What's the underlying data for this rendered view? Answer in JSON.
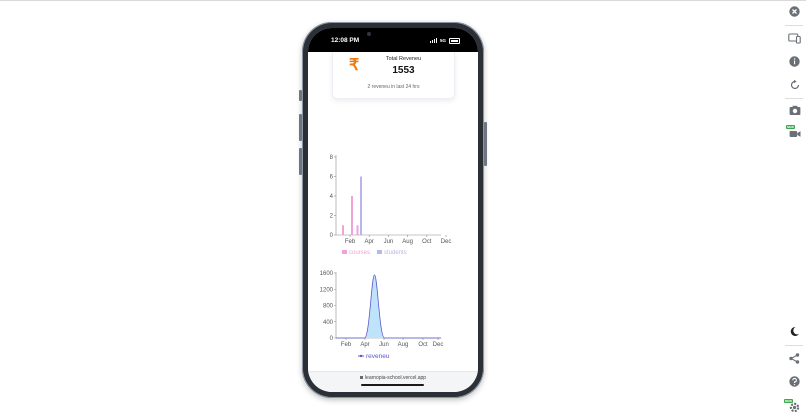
{
  "status_bar": {
    "time": "12:08 PM",
    "network": "5G"
  },
  "revenue_card": {
    "title": "Total Reveneu",
    "value": "1553",
    "subtitle": "2 reveneu in last 24 hrs",
    "icon": "rupee-icon",
    "icon_color": "#f07a10"
  },
  "chart_data": [
    {
      "type": "bar",
      "categories": [
        "Feb",
        "Apr",
        "Jun",
        "Aug",
        "Oct",
        "Dec"
      ],
      "x_tick_labels": [
        "Feb",
        "Apr",
        "Jun",
        "Aug",
        "Oct",
        "Dec"
      ],
      "y_tick_labels": [
        "0",
        "2",
        "4",
        "6",
        "8"
      ],
      "ylim": [
        0,
        8
      ],
      "series": [
        {
          "name": "courses",
          "color": "#f0a3d8",
          "values": [
            1,
            4,
            1,
            0,
            0,
            0
          ]
        },
        {
          "name": "students",
          "color": "#b9b6ef",
          "values": [
            0,
            0,
            6,
            0,
            0,
            0
          ]
        }
      ],
      "legend_position": "bottom"
    },
    {
      "type": "area",
      "x_tick_labels": [
        "Feb",
        "Apr",
        "Jun",
        "Aug",
        "Oct",
        "Dec"
      ],
      "y_tick_labels": [
        "0",
        "400",
        "800",
        "1200",
        "1600"
      ],
      "ylim": [
        0,
        1600
      ],
      "series": [
        {
          "name": "reveneu",
          "color": "#5b57c9",
          "fill": "#bfe3fb",
          "peak_month": "May",
          "peak_value": 1553
        }
      ],
      "legend_position": "bottom"
    }
  ],
  "browser": {
    "url": "learnopia-school.vercel.app"
  },
  "toolbar": {
    "items": [
      "close-icon",
      "device-icon",
      "info-icon",
      "rotate-icon",
      "camera-icon",
      "video-icon",
      "moon-icon",
      "share-icon",
      "help-icon",
      "settings-icon"
    ],
    "new_badge": "NEW"
  }
}
